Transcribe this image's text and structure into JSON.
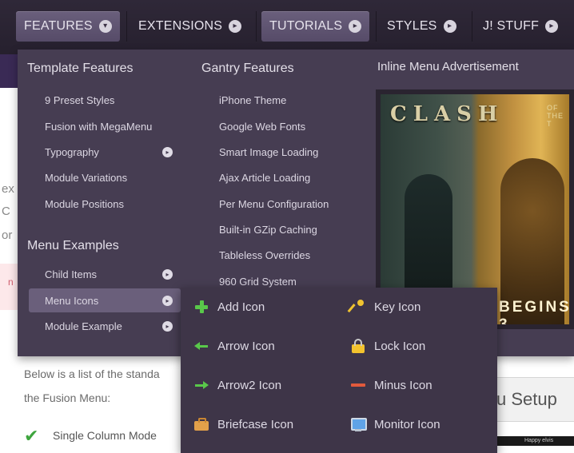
{
  "nav": {
    "items": [
      {
        "label": "FEATURES",
        "arrow": "▾",
        "active": true
      },
      {
        "label": "EXTENSIONS",
        "arrow": "▸",
        "active": false
      },
      {
        "label": "TUTORIALS",
        "arrow": "▸",
        "active": true
      },
      {
        "label": "STYLES",
        "arrow": "▸",
        "active": false
      },
      {
        "label": "J! STUFF",
        "arrow": "▸",
        "active": false
      }
    ]
  },
  "dropdown": {
    "template_features": {
      "heading": "Template Features",
      "items": [
        {
          "label": "9 Preset Styles"
        },
        {
          "label": "Fusion with MegaMenu"
        },
        {
          "label": "Typography",
          "has_child": true
        },
        {
          "label": "Module Variations"
        },
        {
          "label": "Module Positions"
        }
      ]
    },
    "menu_examples": {
      "heading": "Menu Examples",
      "items": [
        {
          "label": "Child Items",
          "has_child": true
        },
        {
          "label": "Menu Icons",
          "has_child": true,
          "active": true
        },
        {
          "label": "Module Example",
          "has_child": true
        }
      ]
    },
    "gantry_features": {
      "heading": "Gantry Features",
      "items": [
        {
          "label": "iPhone Theme"
        },
        {
          "label": "Google Web Fonts"
        },
        {
          "label": "Smart Image Loading"
        },
        {
          "label": "Ajax Article Loading"
        },
        {
          "label": "Per Menu Configuration"
        },
        {
          "label": "Built-in GZip Caching"
        },
        {
          "label": "Tableless Overrides"
        },
        {
          "label": "960 Grid System"
        }
      ]
    },
    "advertisement": {
      "heading": "Inline Menu Advertisement",
      "image_title": "CLASH",
      "image_subtitle": "OF THE T",
      "image_tagline": "BEGINS 3"
    },
    "child_arrow": "▸"
  },
  "icons_submenu": {
    "left": [
      {
        "label": "Add Icon",
        "icon": "plus-icon"
      },
      {
        "label": "Arrow Icon",
        "icon": "arrow-left-icon"
      },
      {
        "label": "Arrow2 Icon",
        "icon": "arrow-right-icon"
      },
      {
        "label": "Briefcase Icon",
        "icon": "briefcase-icon"
      }
    ],
    "right": [
      {
        "label": "Key Icon",
        "icon": "key-icon"
      },
      {
        "label": "Lock Icon",
        "icon": "lock-icon"
      },
      {
        "label": "Minus Icon",
        "icon": "minus-icon"
      },
      {
        "label": "Monitor Icon",
        "icon": "monitor-icon"
      }
    ]
  },
  "page": {
    "side_letters": [
      "ex",
      "C",
      "or"
    ],
    "side_text_red": "n",
    "body_line1": "Below is a list of the standa",
    "body_line2": "the Fusion Menu:",
    "setup_label": "u Setup",
    "checklist_first": "Single Column Mode",
    "bottom_bar_text": "Happy elvis"
  },
  "colors": {
    "nav_bg": "#2b2433",
    "dropdown_bg": "#463d52",
    "highlight": "#6a5f7b",
    "submenu_bg": "#3e3548"
  }
}
